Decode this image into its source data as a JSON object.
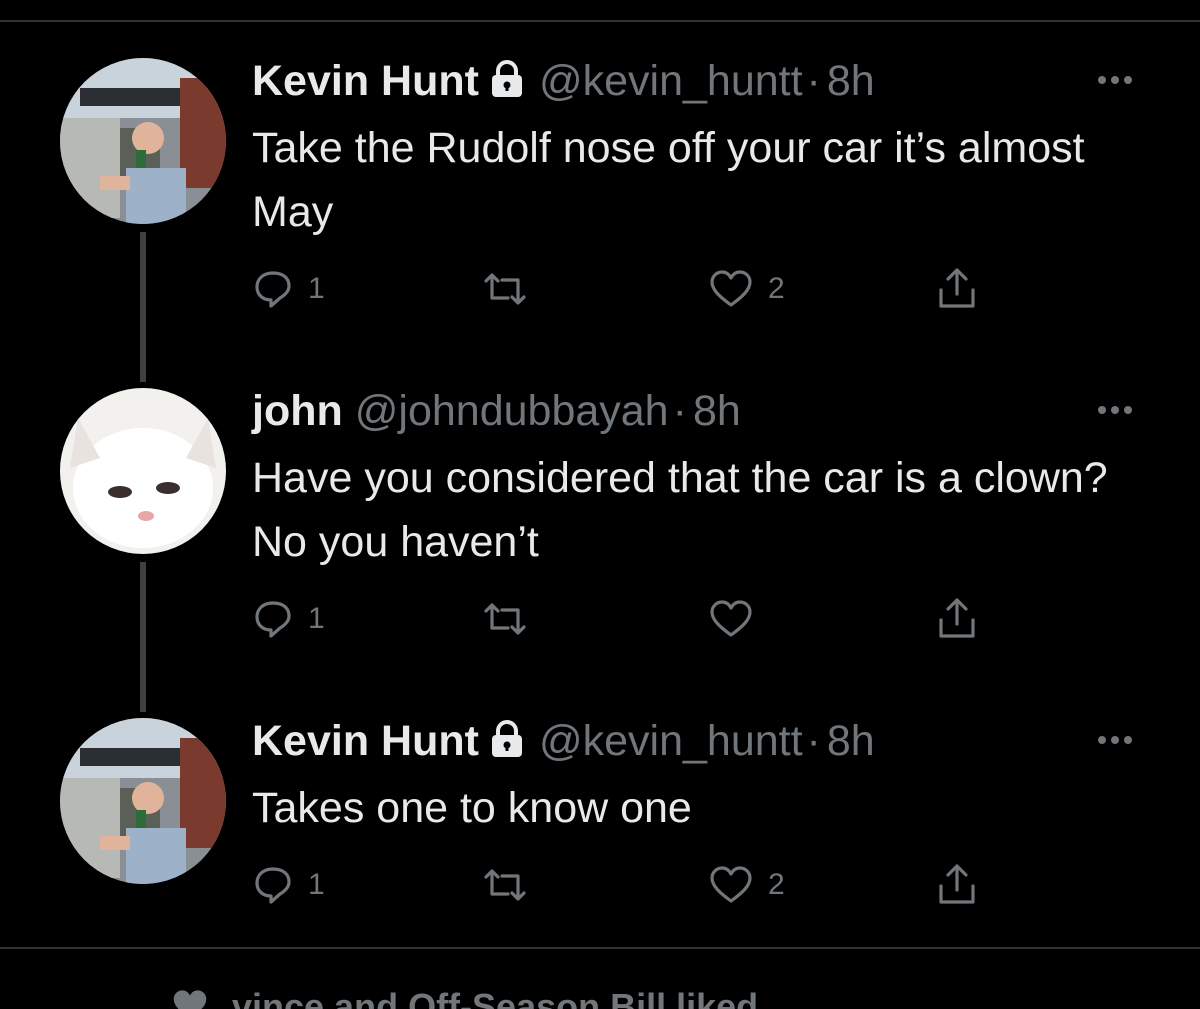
{
  "tweets": [
    {
      "name": "Kevin Hunt",
      "protected": true,
      "handle": "@kevin_huntt",
      "separator": "·",
      "time": "8h",
      "text": "Take the Rudolf nose off your car it’s almost May",
      "replies": "1",
      "retweets": "",
      "likes": "2",
      "avatar_icon": "man-drinking-photo"
    },
    {
      "name": "john",
      "protected": false,
      "handle": "@johndubbayah",
      "separator": "·",
      "time": "8h",
      "text": "Have you considered that the car is a clown? No you haven’t",
      "replies": "1",
      "retweets": "",
      "likes": "",
      "avatar_icon": "white-cat-photo"
    },
    {
      "name": "Kevin Hunt",
      "protected": true,
      "handle": "@kevin_huntt",
      "separator": "·",
      "time": "8h",
      "text": "Takes one to know one",
      "replies": "1",
      "retweets": "",
      "likes": "2",
      "avatar_icon": "man-drinking-photo"
    }
  ],
  "footer": {
    "liked_text": "vince and Off-Season Bill liked"
  },
  "colors": {
    "background": "#000000",
    "primary_text": "#e7e9ea",
    "secondary_text": "#71767b",
    "divider": "#2f3336"
  }
}
